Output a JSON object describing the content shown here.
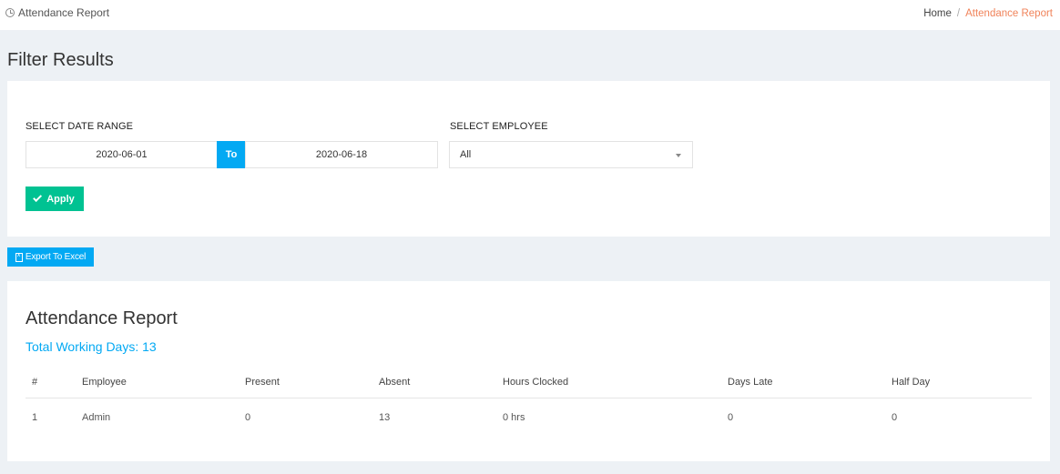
{
  "topbar": {
    "title": "Attendance Report",
    "breadcrumb": {
      "home": "Home",
      "separator": "/",
      "current": "Attendance Report"
    }
  },
  "filter": {
    "heading": "Filter Results",
    "date_range_label": "SELECT DATE RANGE",
    "date_from": "2020-06-01",
    "date_to_addon": "To",
    "date_to": "2020-06-18",
    "employee_label": "SELECT EMPLOYEE",
    "employee_selected": "All",
    "apply_label": "Apply"
  },
  "export_label": "Export To Excel",
  "report": {
    "title": "Attendance Report",
    "working_days": "Total Working Days: 13",
    "columns": [
      "#",
      "Employee",
      "Present",
      "Absent",
      "Hours Clocked",
      "Days Late",
      "Half Day"
    ],
    "rows": [
      [
        "1",
        "Admin",
        "0",
        "13",
        "0 hrs",
        "0",
        "0"
      ]
    ]
  },
  "colors": {
    "accent_blue": "#03a9f3",
    "success_green": "#00c292",
    "breadcrumb_active": "#f0835a",
    "background": "#edf1f5"
  }
}
